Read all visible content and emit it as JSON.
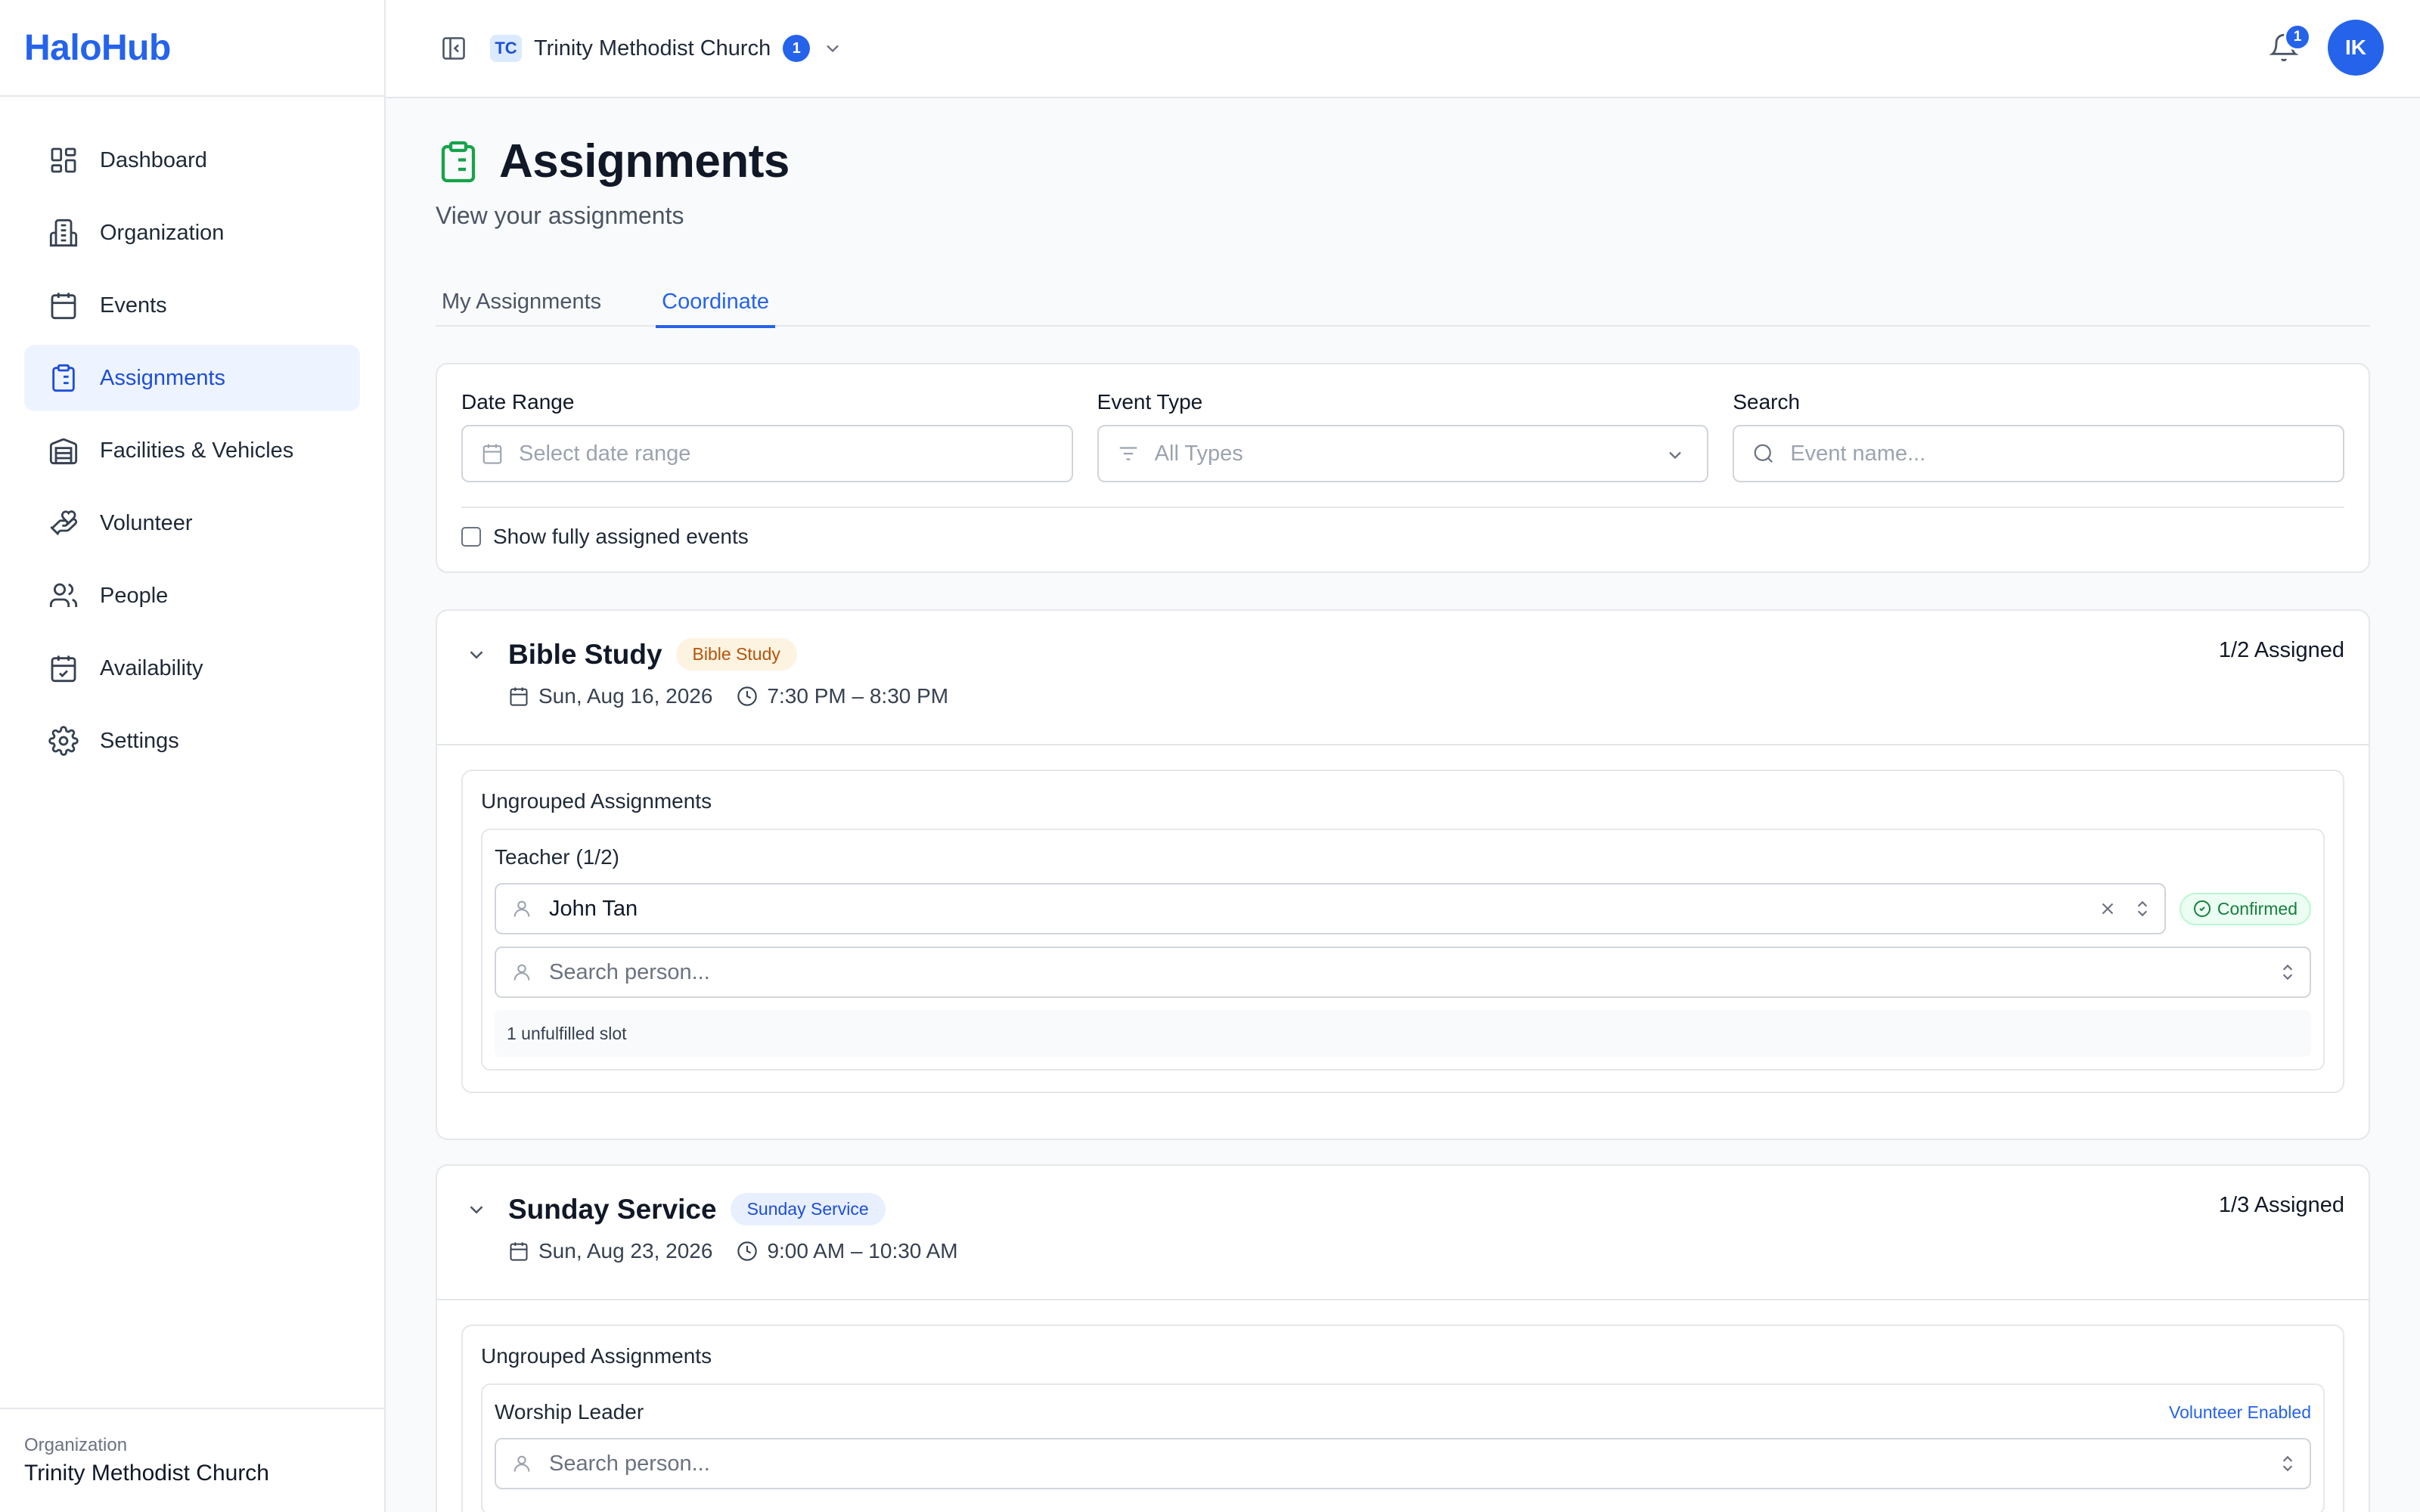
{
  "brand": {
    "name": "HaloHub"
  },
  "sidebar": {
    "items": [
      {
        "label": "Dashboard",
        "icon": "dashboard-icon",
        "active": false
      },
      {
        "label": "Organization",
        "icon": "building-icon",
        "active": false
      },
      {
        "label": "Events",
        "icon": "calendar-icon",
        "active": false
      },
      {
        "label": "Assignments",
        "icon": "clipboard-icon",
        "active": true
      },
      {
        "label": "Facilities & Vehicles",
        "icon": "warehouse-icon",
        "active": false
      },
      {
        "label": "Volunteer",
        "icon": "hand-heart-icon",
        "active": false
      },
      {
        "label": "People",
        "icon": "users-icon",
        "active": false
      },
      {
        "label": "Availability",
        "icon": "calendar-check-icon",
        "active": false
      },
      {
        "label": "Settings",
        "icon": "gear-icon",
        "active": false
      }
    ],
    "footer": {
      "label": "Organization",
      "value": "Trinity Methodist Church"
    }
  },
  "topbar": {
    "org_abbr": "TC",
    "org_name": "Trinity Methodist Church",
    "org_count": "1",
    "notification_count": "1",
    "avatar_initials": "IK"
  },
  "page": {
    "title": "Assignments",
    "subtitle": "View your assignments",
    "tabs": [
      {
        "label": "My Assignments",
        "active": false
      },
      {
        "label": "Coordinate",
        "active": true
      }
    ]
  },
  "filters": {
    "date_range": {
      "label": "Date Range",
      "placeholder": "Select date range"
    },
    "event_type": {
      "label": "Event Type",
      "value": "All Types"
    },
    "search": {
      "label": "Search",
      "placeholder": "Event name..."
    },
    "show_fully_assigned": {
      "label": "Show fully assigned events",
      "checked": false
    }
  },
  "events": [
    {
      "title": "Bible Study",
      "badge": "Bible Study",
      "badge_bg": "#fdf3e1",
      "badge_fg": "#b45309",
      "date": "Sun, Aug 16, 2026",
      "time": "7:30 PM – 8:30 PM",
      "assigned": "1/2 Assigned",
      "group_title": "Ungrouped Assignments",
      "role": "Teacher (1/2)",
      "assignee": "John Tan",
      "status": "Confirmed",
      "search_placeholder": "Search person...",
      "unfilled": "1 unfulfilled slot"
    },
    {
      "title": "Sunday Service",
      "badge": "Sunday Service",
      "badge_bg": "#e8efff",
      "badge_fg": "#1d4ed8",
      "date": "Sun, Aug 23, 2026",
      "time": "9:00 AM – 10:30 AM",
      "assigned": "1/3 Assigned",
      "group_title": "Ungrouped Assignments",
      "role": "Worship Leader",
      "volunteer_status": "Volunteer Enabled",
      "search_placeholder": "Search person..."
    }
  ],
  "colors": {
    "accent": "#2563eb",
    "confirmed": "#15803d",
    "icon_green": "#16a34a"
  }
}
